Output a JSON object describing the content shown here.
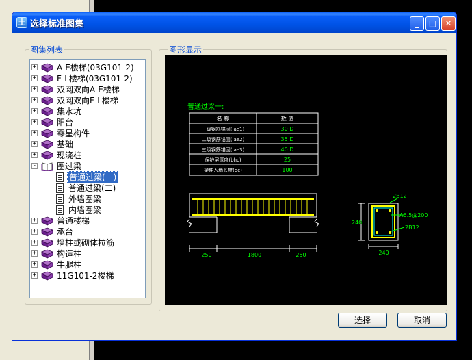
{
  "window": {
    "title": "选择标准图集"
  },
  "tree_panel": {
    "label": "图集列表"
  },
  "preview_panel": {
    "label": "图形显示"
  },
  "tree": [
    {
      "label": "A-E楼梯(03G101-2)",
      "expander": "+",
      "type": "folder"
    },
    {
      "label": "F-L楼梯(03G101-2)",
      "expander": "+",
      "type": "folder"
    },
    {
      "label": "双网双向A-E楼梯",
      "expander": "+",
      "type": "folder"
    },
    {
      "label": "双网双向F-L楼梯",
      "expander": "+",
      "type": "folder"
    },
    {
      "label": "集水坑",
      "expander": "+",
      "type": "folder"
    },
    {
      "label": "阳台",
      "expander": "+",
      "type": "folder"
    },
    {
      "label": "零星构件",
      "expander": "+",
      "type": "folder"
    },
    {
      "label": "基础",
      "expander": "+",
      "type": "folder"
    },
    {
      "label": "现浇桩",
      "expander": "+",
      "type": "folder"
    },
    {
      "label": "圈过梁",
      "expander": "-",
      "type": "open-folder"
    },
    {
      "label": "普通过梁(一)",
      "type": "doc",
      "selected": true
    },
    {
      "label": "普通过梁(二)",
      "type": "doc"
    },
    {
      "label": "外墙圈梁",
      "type": "doc"
    },
    {
      "label": "内墙圈梁",
      "type": "doc"
    },
    {
      "label": "普通楼梯",
      "expander": "+",
      "type": "folder"
    },
    {
      "label": "承台",
      "expander": "+",
      "type": "folder"
    },
    {
      "label": "墙柱或砌体拉筋",
      "expander": "+",
      "type": "folder"
    },
    {
      "label": "构造柱",
      "expander": "+",
      "type": "folder"
    },
    {
      "label": "牛腿柱",
      "expander": "+",
      "type": "folder"
    },
    {
      "label": "11G101-2楼梯",
      "expander": "+",
      "type": "folder"
    }
  ],
  "drawing": {
    "title": "普通过梁一:",
    "table_header": [
      "名 称",
      "数 值"
    ],
    "table_rows": [
      [
        "一级钢筋锚固(lae1)",
        "30 D"
      ],
      [
        "二级钢筋锚固(lae2)",
        "35 D"
      ],
      [
        "三级钢筋锚固(lae3)",
        "40 D"
      ],
      [
        "保护层厚度(bhc)",
        "25"
      ],
      [
        "梁伸入墙长度(qc)",
        "100"
      ]
    ],
    "dim_left": "250",
    "dim_mid": "1800",
    "dim_right": "250",
    "section_top_bar": "2B12",
    "section_stirrup": "A6.5@200",
    "section_bottom_bar": "2B12",
    "section_height": "240",
    "section_width": "240"
  },
  "buttons": {
    "ok": "选择",
    "cancel": "取消"
  },
  "colors": {
    "accent": "#0054e3",
    "drawing_label": "#00ff00",
    "rebar": "#ffff00",
    "stirrup": "#00ffff"
  }
}
